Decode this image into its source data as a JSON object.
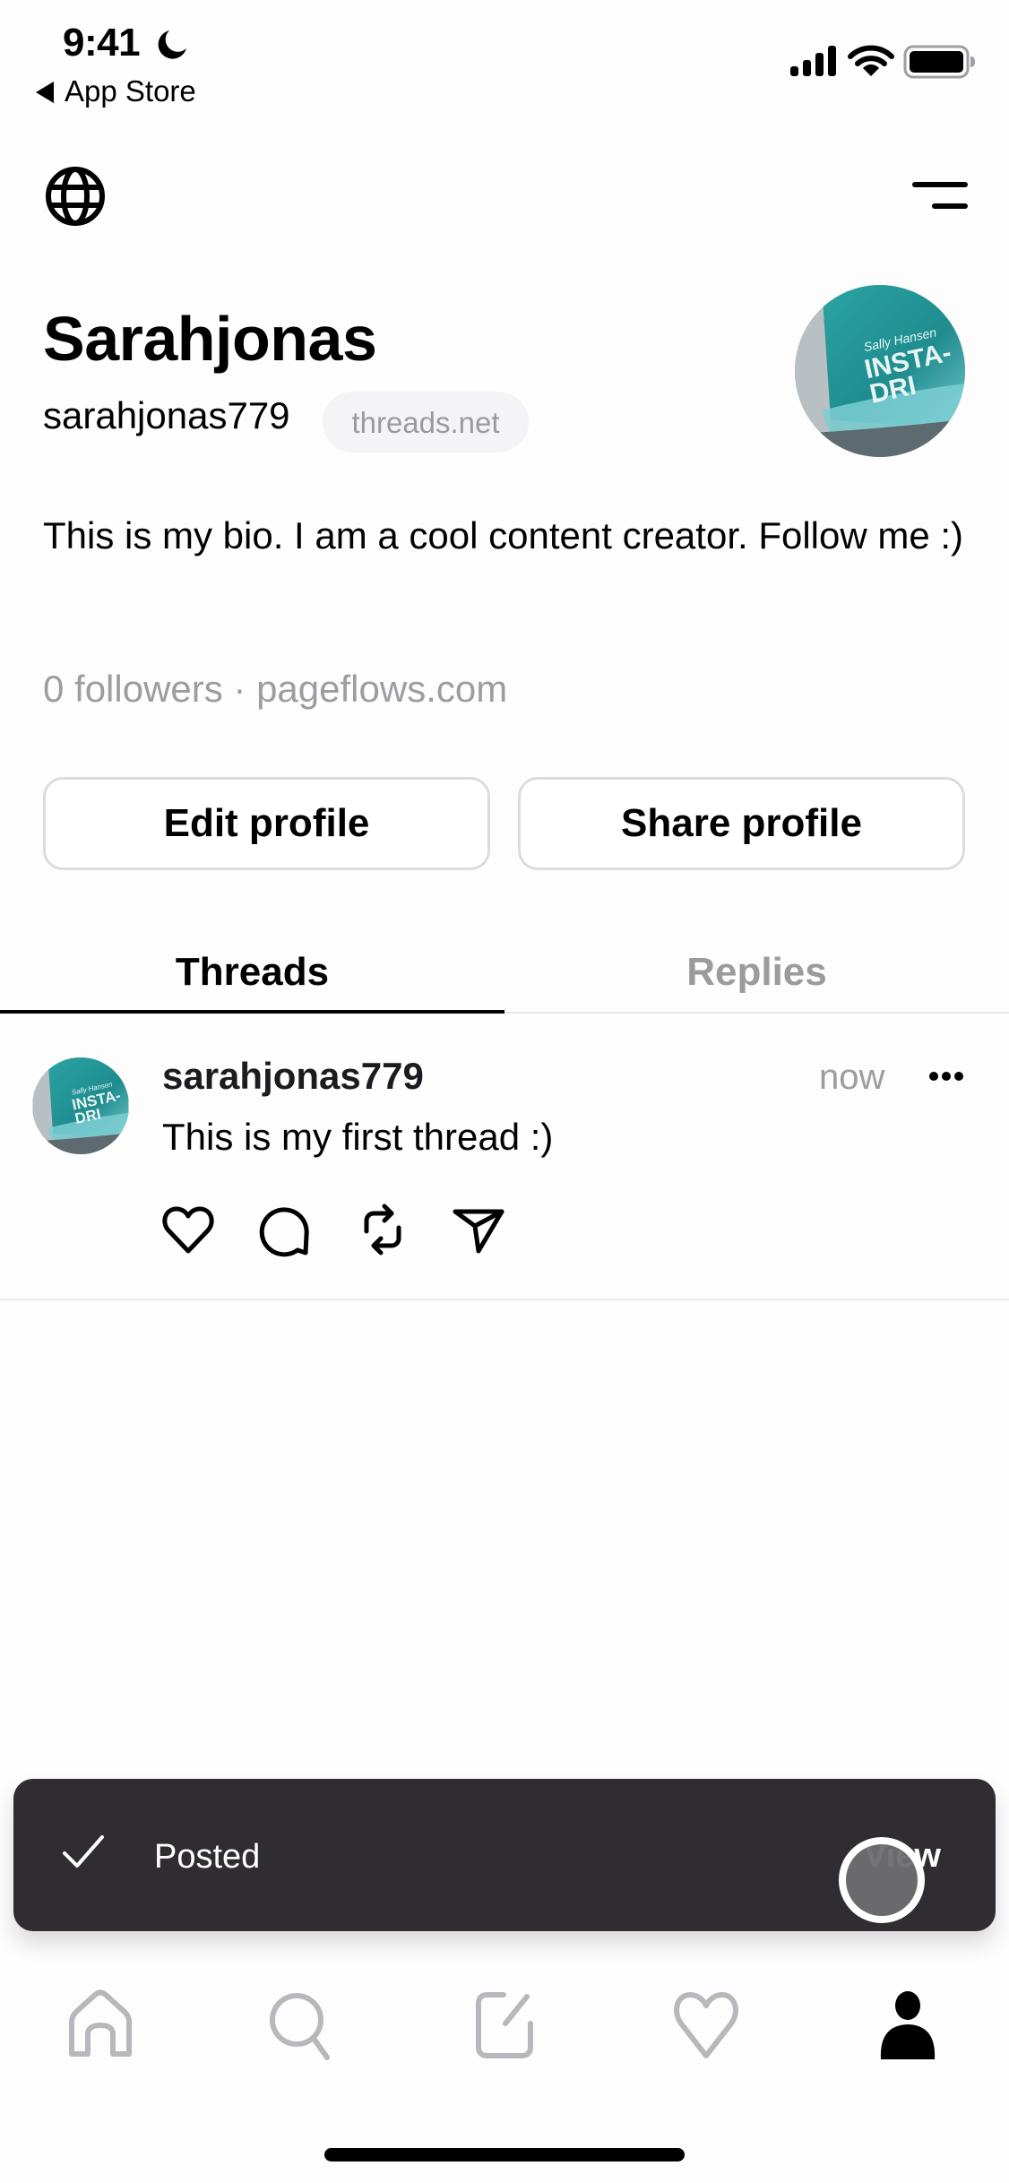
{
  "status_bar": {
    "time": "9:41",
    "back_label": "App Store",
    "icons": [
      "moon-icon",
      "signal-icon",
      "wifi-icon",
      "battery-icon"
    ]
  },
  "header": {
    "left_icon": "globe-icon",
    "right_icon": "menu-icon"
  },
  "profile": {
    "display_name": "Sarahjonas",
    "handle": "sarahjonas779",
    "domain_badge": "threads.net",
    "bio": "This is my bio. I am a cool content creator. Follow me :)",
    "meta": "0 followers · pageflows.com",
    "avatar_colors": {
      "primary": "#2a9a9a",
      "accent": "#1f7f82"
    }
  },
  "buttons": {
    "edit_profile": "Edit profile",
    "share_profile": "Share profile"
  },
  "tabs": [
    {
      "label": "Threads",
      "active": true
    },
    {
      "label": "Replies",
      "active": false
    }
  ],
  "posts": [
    {
      "username": "sarahjonas779",
      "time": "now",
      "text": "This is my first thread :)",
      "actions": [
        "like",
        "comment",
        "repost",
        "share"
      ]
    }
  ],
  "toast": {
    "label": "Posted",
    "action": "View",
    "icon": "check-icon",
    "background": "#2f2d31"
  },
  "tab_bar": {
    "items": [
      {
        "name": "home",
        "active": false
      },
      {
        "name": "search",
        "active": false
      },
      {
        "name": "compose",
        "active": false
      },
      {
        "name": "activity",
        "active": false
      },
      {
        "name": "profile",
        "active": true
      }
    ],
    "active_color": "#000000",
    "inactive_color": "#b8b7bb"
  }
}
